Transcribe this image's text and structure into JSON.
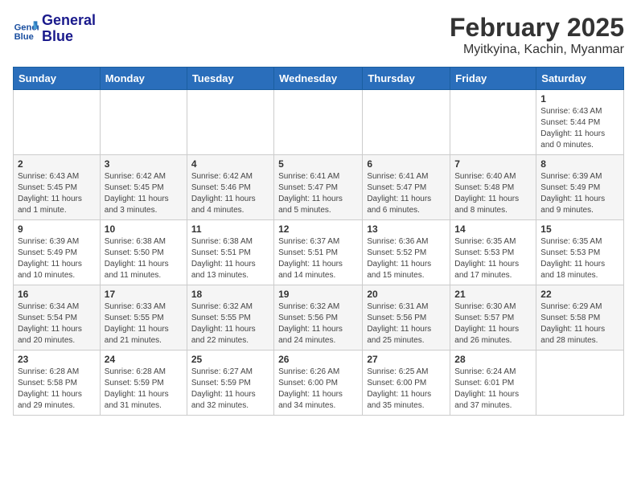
{
  "header": {
    "logo_line1": "General",
    "logo_line2": "Blue",
    "title": "February 2025",
    "subtitle": "Myitkyina, Kachin, Myanmar"
  },
  "days_of_week": [
    "Sunday",
    "Monday",
    "Tuesday",
    "Wednesday",
    "Thursday",
    "Friday",
    "Saturday"
  ],
  "weeks": [
    [
      {
        "day": "",
        "info": ""
      },
      {
        "day": "",
        "info": ""
      },
      {
        "day": "",
        "info": ""
      },
      {
        "day": "",
        "info": ""
      },
      {
        "day": "",
        "info": ""
      },
      {
        "day": "",
        "info": ""
      },
      {
        "day": "1",
        "info": "Sunrise: 6:43 AM\nSunset: 5:44 PM\nDaylight: 11 hours\nand 0 minutes."
      }
    ],
    [
      {
        "day": "2",
        "info": "Sunrise: 6:43 AM\nSunset: 5:45 PM\nDaylight: 11 hours\nand 1 minute."
      },
      {
        "day": "3",
        "info": "Sunrise: 6:42 AM\nSunset: 5:45 PM\nDaylight: 11 hours\nand 3 minutes."
      },
      {
        "day": "4",
        "info": "Sunrise: 6:42 AM\nSunset: 5:46 PM\nDaylight: 11 hours\nand 4 minutes."
      },
      {
        "day": "5",
        "info": "Sunrise: 6:41 AM\nSunset: 5:47 PM\nDaylight: 11 hours\nand 5 minutes."
      },
      {
        "day": "6",
        "info": "Sunrise: 6:41 AM\nSunset: 5:47 PM\nDaylight: 11 hours\nand 6 minutes."
      },
      {
        "day": "7",
        "info": "Sunrise: 6:40 AM\nSunset: 5:48 PM\nDaylight: 11 hours\nand 8 minutes."
      },
      {
        "day": "8",
        "info": "Sunrise: 6:39 AM\nSunset: 5:49 PM\nDaylight: 11 hours\nand 9 minutes."
      }
    ],
    [
      {
        "day": "9",
        "info": "Sunrise: 6:39 AM\nSunset: 5:49 PM\nDaylight: 11 hours\nand 10 minutes."
      },
      {
        "day": "10",
        "info": "Sunrise: 6:38 AM\nSunset: 5:50 PM\nDaylight: 11 hours\nand 11 minutes."
      },
      {
        "day": "11",
        "info": "Sunrise: 6:38 AM\nSunset: 5:51 PM\nDaylight: 11 hours\nand 13 minutes."
      },
      {
        "day": "12",
        "info": "Sunrise: 6:37 AM\nSunset: 5:51 PM\nDaylight: 11 hours\nand 14 minutes."
      },
      {
        "day": "13",
        "info": "Sunrise: 6:36 AM\nSunset: 5:52 PM\nDaylight: 11 hours\nand 15 minutes."
      },
      {
        "day": "14",
        "info": "Sunrise: 6:35 AM\nSunset: 5:53 PM\nDaylight: 11 hours\nand 17 minutes."
      },
      {
        "day": "15",
        "info": "Sunrise: 6:35 AM\nSunset: 5:53 PM\nDaylight: 11 hours\nand 18 minutes."
      }
    ],
    [
      {
        "day": "16",
        "info": "Sunrise: 6:34 AM\nSunset: 5:54 PM\nDaylight: 11 hours\nand 20 minutes."
      },
      {
        "day": "17",
        "info": "Sunrise: 6:33 AM\nSunset: 5:55 PM\nDaylight: 11 hours\nand 21 minutes."
      },
      {
        "day": "18",
        "info": "Sunrise: 6:32 AM\nSunset: 5:55 PM\nDaylight: 11 hours\nand 22 minutes."
      },
      {
        "day": "19",
        "info": "Sunrise: 6:32 AM\nSunset: 5:56 PM\nDaylight: 11 hours\nand 24 minutes."
      },
      {
        "day": "20",
        "info": "Sunrise: 6:31 AM\nSunset: 5:56 PM\nDaylight: 11 hours\nand 25 minutes."
      },
      {
        "day": "21",
        "info": "Sunrise: 6:30 AM\nSunset: 5:57 PM\nDaylight: 11 hours\nand 26 minutes."
      },
      {
        "day": "22",
        "info": "Sunrise: 6:29 AM\nSunset: 5:58 PM\nDaylight: 11 hours\nand 28 minutes."
      }
    ],
    [
      {
        "day": "23",
        "info": "Sunrise: 6:28 AM\nSunset: 5:58 PM\nDaylight: 11 hours\nand 29 minutes."
      },
      {
        "day": "24",
        "info": "Sunrise: 6:28 AM\nSunset: 5:59 PM\nDaylight: 11 hours\nand 31 minutes."
      },
      {
        "day": "25",
        "info": "Sunrise: 6:27 AM\nSunset: 5:59 PM\nDaylight: 11 hours\nand 32 minutes."
      },
      {
        "day": "26",
        "info": "Sunrise: 6:26 AM\nSunset: 6:00 PM\nDaylight: 11 hours\nand 34 minutes."
      },
      {
        "day": "27",
        "info": "Sunrise: 6:25 AM\nSunset: 6:00 PM\nDaylight: 11 hours\nand 35 minutes."
      },
      {
        "day": "28",
        "info": "Sunrise: 6:24 AM\nSunset: 6:01 PM\nDaylight: 11 hours\nand 37 minutes."
      },
      {
        "day": "",
        "info": ""
      }
    ]
  ]
}
